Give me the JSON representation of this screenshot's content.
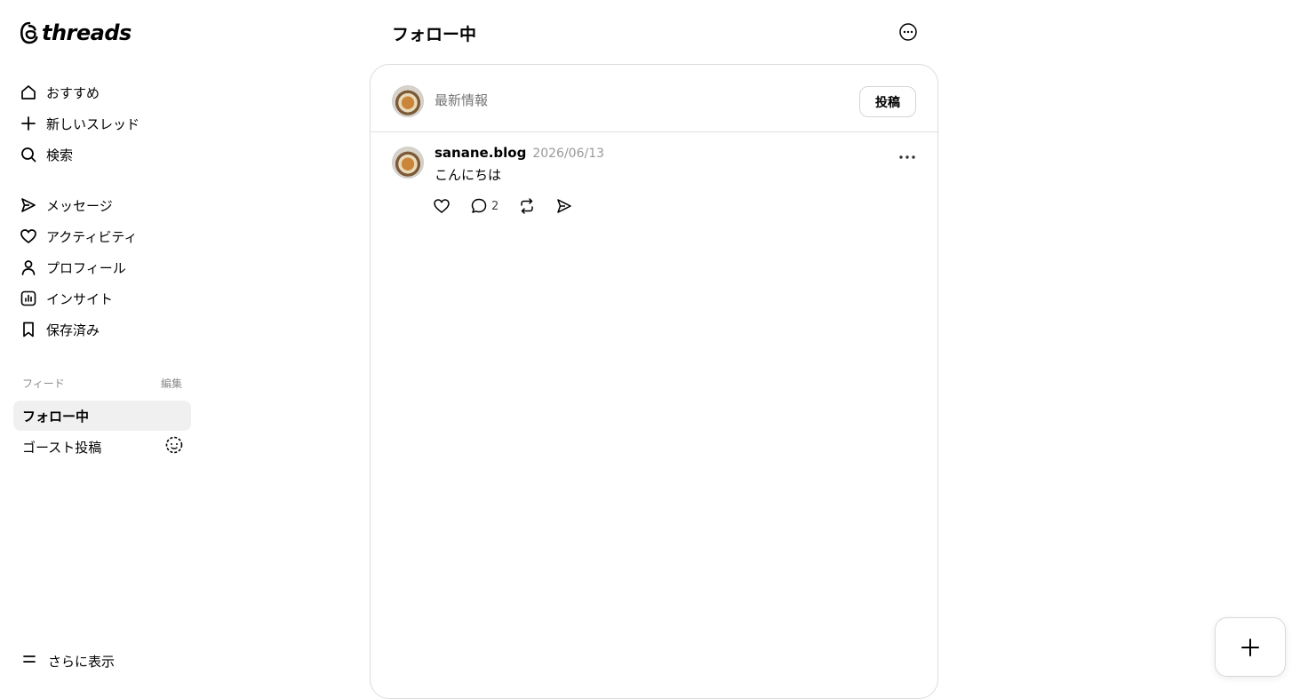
{
  "brand": {
    "name": "threads"
  },
  "sidebar": {
    "nav": [
      {
        "label": "おすすめ",
        "icon": "home-icon"
      },
      {
        "label": "新しいスレッド",
        "icon": "plus-icon"
      },
      {
        "label": "検索",
        "icon": "search-icon"
      },
      {
        "label": "メッセージ",
        "icon": "send-icon"
      },
      {
        "label": "アクティビティ",
        "icon": "heart-icon"
      },
      {
        "label": "プロフィール",
        "icon": "user-icon"
      },
      {
        "label": "インサイト",
        "icon": "insights-icon"
      },
      {
        "label": "保存済み",
        "icon": "bookmark-icon"
      }
    ],
    "feeds_label": "フィード",
    "feeds_edit": "編集",
    "feeds": [
      {
        "label": "フォロー中",
        "active": true
      },
      {
        "label": "ゴースト投稿",
        "icon": "ghost-icon"
      }
    ],
    "more_label": "さらに表示"
  },
  "main": {
    "title": "フォロー中",
    "composer": {
      "placeholder": "最新情報",
      "post_button": "投稿"
    },
    "posts": [
      {
        "username": "sanane.blog",
        "date": "2026/06/13",
        "text": "こんにちは",
        "reply_count": "2"
      }
    ]
  },
  "colors": {
    "active_feed_bg": "#f0f0f0",
    "muted_text": "#999999",
    "border": "#dcdcdc"
  }
}
